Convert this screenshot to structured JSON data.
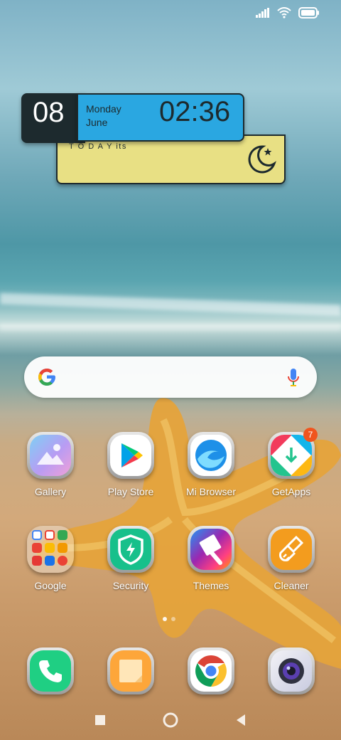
{
  "status_bar": {
    "icons": [
      "signal-icon",
      "wifi-icon",
      "battery-icon"
    ]
  },
  "widget": {
    "day": "08",
    "weekday": "Monday",
    "month": "June",
    "time": "02:36",
    "note": "T O D A Y its",
    "icon": "moon-star-icon"
  },
  "search": {
    "icons": [
      "google-g-icon",
      "microphone-icon"
    ]
  },
  "apps_row1": [
    {
      "label": "Gallery"
    },
    {
      "label": "Play Store"
    },
    {
      "label": "Mi Browser"
    },
    {
      "label": "GetApps",
      "badge": "7"
    }
  ],
  "apps_row2": [
    {
      "label": "Google"
    },
    {
      "label": "Security"
    },
    {
      "label": "Themes"
    },
    {
      "label": "Cleaner"
    }
  ],
  "dock": [
    {
      "name": "phone-icon"
    },
    {
      "name": "notes-icon"
    },
    {
      "name": "chrome-icon"
    },
    {
      "name": "camera-icon"
    }
  ],
  "page_indicator": {
    "current": 1,
    "total": 2
  },
  "colors": {
    "widget_blue": "#2aa7e1",
    "widget_yellow": "#e8e084",
    "widget_dark": "#1d2a2e",
    "badge": "#f0541e"
  }
}
